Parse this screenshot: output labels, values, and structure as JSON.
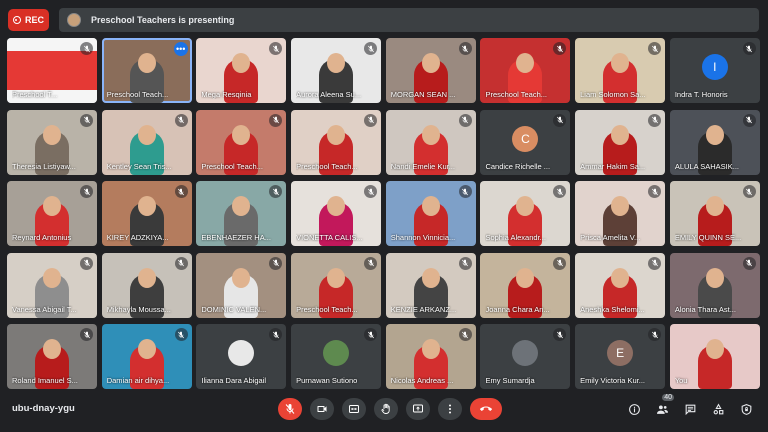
{
  "header": {
    "rec_label": "REC",
    "presenting_text": "Preschool Teachers is presenting"
  },
  "tiles": [
    {
      "name": "Preschool T...",
      "kind": "share",
      "bg": "#d7d7d7"
    },
    {
      "name": "Preschool Teach...",
      "kind": "video",
      "bg": "#8a6d5a",
      "active": true,
      "more": true
    },
    {
      "name": "Mega Resqinia",
      "kind": "video",
      "bg": "#e9d6cf",
      "shirt": "#c62828"
    },
    {
      "name": "Aurora Aleena Su...",
      "kind": "video",
      "bg": "#e8e8e8",
      "shirt": "#3a3a3a"
    },
    {
      "name": "MORGAN SEAN ...",
      "kind": "video",
      "bg": "#9a8a80",
      "shirt": "#b71c1c"
    },
    {
      "name": "Preschool Teach...",
      "kind": "video",
      "bg": "#c53030",
      "shirt": "#e53935"
    },
    {
      "name": "Liam Solomon Sa...",
      "kind": "video",
      "bg": "#d8cbb0",
      "shirt": "#d32f2f"
    },
    {
      "name": "Indra T. Honoris",
      "kind": "avatar",
      "initial": "I",
      "avatarColor": "#1a73e8"
    },
    {
      "name": "Theresia Listiyaw...",
      "kind": "video",
      "bg": "#b9b3a8",
      "shirt": "#7a6e62"
    },
    {
      "name": "Kentley Sean Tris...",
      "kind": "video",
      "bg": "#d7c2b6",
      "shirt": "#2e9c8f"
    },
    {
      "name": "Preschool Teach...",
      "kind": "video",
      "bg": "#c47b6b",
      "shirt": "#c62828"
    },
    {
      "name": "Preschool Teach...",
      "kind": "video",
      "bg": "#e0d0c6",
      "shirt": "#c62828"
    },
    {
      "name": "Nandi Emelie Kur...",
      "kind": "video",
      "bg": "#cfc7c0",
      "shirt": "#d32f2f"
    },
    {
      "name": "Candice Richelle ...",
      "kind": "avatar",
      "initial": "C",
      "avatarColor": "#d98d62"
    },
    {
      "name": "Ammar Hakim Sa...",
      "kind": "video",
      "bg": "#d7d2cc",
      "shirt": "#b71c1c"
    },
    {
      "name": "ALULA SAHASIK...",
      "kind": "video",
      "bg": "#4d5158",
      "shirt": "#2b2b2b"
    },
    {
      "name": "Reynard Antonius",
      "kind": "video",
      "bg": "#a7a097",
      "shirt": "#d32f2f"
    },
    {
      "name": "KIREY ADZKIYA...",
      "kind": "video",
      "bg": "#b47c5e",
      "shirt": "#3a3a3a"
    },
    {
      "name": "EBENHAEZER HA...",
      "kind": "video",
      "bg": "#88a8a6",
      "shirt": "#6a6a6a"
    },
    {
      "name": "VIONETTA CALIS...",
      "kind": "video",
      "bg": "#e6e1dc",
      "shirt": "#c2185b"
    },
    {
      "name": "Shannon Vinnicia...",
      "kind": "video",
      "bg": "#7ea0c8",
      "shirt": "#c62828"
    },
    {
      "name": "Sophia Alexandr...",
      "kind": "video",
      "bg": "#dcd7d0",
      "shirt": "#d32f2f"
    },
    {
      "name": "Prisca Amelita V...",
      "kind": "video",
      "bg": "#e1d3cd",
      "shirt": "#5d4037"
    },
    {
      "name": "EMILY QUINN SE...",
      "kind": "video",
      "bg": "#c9c3b8",
      "shirt": "#b71c1c"
    },
    {
      "name": "Vanessa Abigail T...",
      "kind": "video",
      "bg": "#d6cfc6",
      "shirt": "#8e8e8e"
    },
    {
      "name": "Mikhayla Moussa...",
      "kind": "video",
      "bg": "#c6c1b9",
      "shirt": "#3e3e3e"
    },
    {
      "name": "DOMINIC VALEN...",
      "kind": "video",
      "bg": "#a39080",
      "shirt": "#e6e6e6"
    },
    {
      "name": "Preschool Teach...",
      "kind": "video",
      "bg": "#b8aa98",
      "shirt": "#c62828"
    },
    {
      "name": "KENZIE ARKANZ...",
      "kind": "video",
      "bg": "#d3cac0",
      "shirt": "#444444"
    },
    {
      "name": "Joanna Chara An...",
      "kind": "video",
      "bg": "#c4b49c",
      "shirt": "#b71c1c"
    },
    {
      "name": "Aneshka Shelomi...",
      "kind": "video",
      "bg": "#dcd6ce",
      "shirt": "#c62828"
    },
    {
      "name": "Alonia Thara Ast...",
      "kind": "video",
      "bg": "#7d6a6e",
      "shirt": "#4a4a4a"
    },
    {
      "name": "Roland Imanuel S...",
      "kind": "video",
      "bg": "#7c7a78",
      "shirt": "#b71c1c"
    },
    {
      "name": "Damian air dihya...",
      "kind": "video",
      "bg": "#2f8fb8",
      "shirt": "#d32f2f"
    },
    {
      "name": "Ilianna Dara Abigail",
      "kind": "avatar",
      "initial": "",
      "avatarColor": "#e8e8e8"
    },
    {
      "name": "Purnawan Sutiono",
      "kind": "avatar",
      "initial": "",
      "avatarColor": "#5e8a4f"
    },
    {
      "name": "Nicolas Andreas ...",
      "kind": "video",
      "bg": "#b3a590",
      "shirt": "#d32f2f"
    },
    {
      "name": "Emy Sumardja",
      "kind": "avatar",
      "initial": "",
      "avatarColor": "#6d7278"
    },
    {
      "name": "Emily Victoria Kur...",
      "kind": "avatar",
      "initial": "E",
      "avatarColor": "#8d6e63"
    },
    {
      "name": "You",
      "kind": "video",
      "bg": "#e7c9c8",
      "shirt": "#c62828"
    }
  ],
  "footer": {
    "meeting_code": "ubu-dnay-ygu",
    "participants_count": "40"
  },
  "colors": {
    "background": "#202124",
    "surface": "#3c4043",
    "accent": "#1a73e8",
    "danger": "#ea4335"
  }
}
